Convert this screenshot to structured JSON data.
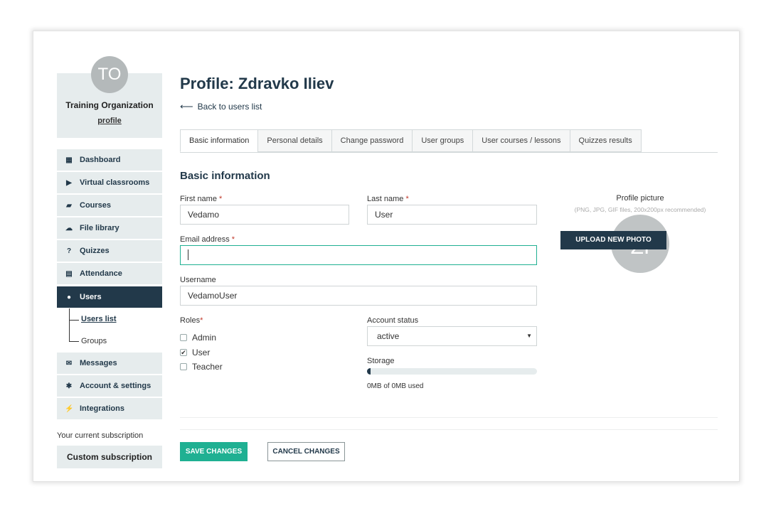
{
  "org": {
    "initials": "TO",
    "name": "Training Organization",
    "profile_link": "profile"
  },
  "sidebar": {
    "items": [
      {
        "label": "Dashboard",
        "icon": "grid-icon"
      },
      {
        "label": "Virtual classrooms",
        "icon": "play-circle-icon"
      },
      {
        "label": "Courses",
        "icon": "book-icon"
      },
      {
        "label": "File library",
        "icon": "cloud-upload-icon"
      },
      {
        "label": "Quizzes",
        "icon": "question-circle-icon"
      },
      {
        "label": "Attendance",
        "icon": "document-icon"
      },
      {
        "label": "Users",
        "icon": "users-icon"
      },
      {
        "label": "Messages",
        "icon": "envelope-icon"
      },
      {
        "label": "Account & settings",
        "icon": "gear-icon"
      },
      {
        "label": "Integrations",
        "icon": "plug-icon"
      }
    ],
    "users_sub": [
      "Users list",
      "Groups"
    ],
    "subscription_label": "Your current subscription",
    "subscription_name": "Custom subscription"
  },
  "main": {
    "title": "Profile: Zdravko Iliev",
    "back_link": "Back to users list",
    "tabs": [
      "Basic information",
      "Personal details",
      "Change password",
      "User groups",
      "User courses / lessons",
      "Quizzes results"
    ],
    "section_title": "Basic information",
    "form": {
      "first_name_label": "First name",
      "first_name_value": "Vedamo",
      "last_name_label": "Last name",
      "last_name_value": "User",
      "email_label": "Email address",
      "email_value": "",
      "username_label": "Username",
      "username_value": "VedamoUser",
      "roles_label": "Roles",
      "roles": [
        {
          "label": "Admin",
          "checked": false
        },
        {
          "label": "User",
          "checked": true
        },
        {
          "label": "Teacher",
          "checked": false
        }
      ],
      "required_mark": "*",
      "account_status_label": "Account status",
      "account_status_value": "active",
      "storage_label": "Storage",
      "storage_used_fraction": 0.02,
      "storage_text": "0MB of 0MB used"
    },
    "picture": {
      "title": "Profile picture",
      "hint": "(PNG, JPG, GIF files, 200x200px recommended)",
      "initials": "ZI",
      "upload_label": "UPLOAD NEW PHOTO"
    },
    "actions": {
      "save_label": "SAVE CHANGES",
      "cancel_label": "CANCEL CHANGES"
    }
  },
  "colors": {
    "navy": "#22394a",
    "teal": "#1fb092",
    "sidebar_bg": "#e6eced"
  }
}
